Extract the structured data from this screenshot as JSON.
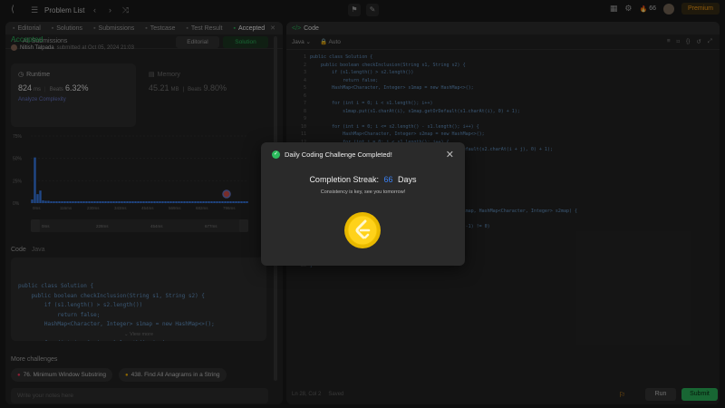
{
  "topbar": {
    "problem_list": "Problem List",
    "streak_count": "66",
    "premium": "Premium"
  },
  "left": {
    "tabs": [
      {
        "icon": "book-icon",
        "label": "Editorial"
      },
      {
        "icon": "flask-icon",
        "label": "Solutions"
      },
      {
        "icon": "clock-icon",
        "label": "Submissions"
      },
      {
        "icon": "check-icon",
        "label": "Testcase"
      },
      {
        "icon": "terminal-icon",
        "label": "Test Result"
      },
      {
        "icon": "check-icon",
        "label": "Accepted"
      }
    ],
    "back_label": "All Submissions",
    "status": "Accepted",
    "user": "Nitish Talpada",
    "submitted_at": "submitted at Oct 05, 2024 21:03",
    "editorial_button": "Editorial",
    "solution_button": "Solution",
    "runtime": {
      "label": "Runtime",
      "value": "824",
      "unit": "ms",
      "beats_label": "Beats",
      "beats": "6.32%",
      "analyze": "Analyze Complexity"
    },
    "memory": {
      "label": "Memory",
      "value": "45.21",
      "unit": "MB",
      "beats_label": "Beats",
      "beats": "9.80%"
    },
    "code_label": "Code",
    "code_lang": "Java",
    "code_lines": [
      "public class Solution {",
      "    public boolean checkInclusion(String s1, String s2) {",
      "        if (s1.length() > s2.length())",
      "            return false;",
      "        HashMap<Character, Integer> s1map = new HashMap<>();",
      "",
      "        for (int i = 0; i < s1.length(); i++)",
      "            s1map.put(s1.charAt(i), s1map.getOrDefault(s1.charAt(i), 0) +"
    ],
    "view_more": "View more",
    "more_challenges": "More challenges",
    "challenges": [
      "76. Minimum Window Substring",
      "438. Find All Anagrams in a String"
    ],
    "notes_placeholder": "Write your notes here"
  },
  "chart_data": {
    "type": "bar",
    "yticks": [
      "75%",
      "50%",
      "25%",
      "0%"
    ],
    "xticks": [
      "0ms",
      "116ms",
      "230ms",
      "343ms",
      "454ms",
      "569ms",
      "682ms",
      "796ms"
    ],
    "xticks2": [
      "0ms",
      "228ms",
      "454ms",
      "677ms"
    ],
    "ylim": [
      0,
      75
    ],
    "values": [
      4,
      51,
      10,
      14,
      3,
      2.5,
      2.5,
      2,
      2,
      2,
      2,
      2,
      2,
      2,
      2,
      2,
      2,
      2,
      2,
      2,
      2,
      2,
      2,
      2,
      2,
      2,
      2,
      2,
      2,
      2,
      2,
      2,
      2,
      2,
      2,
      2,
      2,
      2,
      2,
      2,
      2,
      2,
      2,
      2,
      2,
      2,
      2,
      2,
      2,
      2,
      2,
      2,
      2,
      2,
      2,
      2,
      2,
      2,
      2,
      2,
      2,
      2,
      2,
      2,
      2,
      2,
      2,
      2,
      2,
      2,
      2,
      2,
      2,
      2,
      2,
      2,
      2,
      2,
      2,
      2
    ],
    "accent": "#3b82f6"
  },
  "right": {
    "title": "Code",
    "lang": "Java",
    "auto": "Auto",
    "code_lines": [
      "public class Solution {",
      "    public boolean checkInclusion(String s1, String s2) {",
      "        if (s1.length() > s2.length())",
      "            return false;",
      "        HashMap<Character, Integer> s1map = new HashMap<>();",
      "",
      "        for (int i = 0; i < s1.length(); i++)",
      "            s1map.put(s1.charAt(i), s1map.getOrDefault(s1.charAt(i), 0) + 1);",
      "",
      "        for (int i = 0; i <= s2.length() - s1.length(); i++) {",
      "            HashMap<Character, Integer> s2map = new HashMap<>();",
      "            for (int j = 0; j < s1.length(); j++) {",
      "                s2map.put(s2.charAt(i + j), s2map.getOrDefault(s2.charAt(i + j), 0) + 1);",
      "            }",
      "            if (matches(s1map, s2map))",
      "                return true;",
      "        }",
      "        return false;",
      "    }",
      "",
      "    public boolean matches(HashMap<Character, Integer> s1map, HashMap<Character, Integer> s2map) {",
      "        for (char key : s1map.keySet()) {",
      "            if (s1map.get(key) - s2map.getOrDefault(key, -1) != 0)",
      "                return false;",
      "        }",
      "        return true;",
      "    }",
      "}"
    ],
    "cursor": "Ln 28, Col 2",
    "saved": "Saved",
    "run": "Run",
    "submit": "Submit"
  },
  "modal": {
    "title": "Daily Coding Challenge Completed!",
    "streak_label": "Completion Streak:",
    "streak_value": "66",
    "streak_unit": "Days",
    "message": "Consistency is key, see you tomorrow!"
  }
}
